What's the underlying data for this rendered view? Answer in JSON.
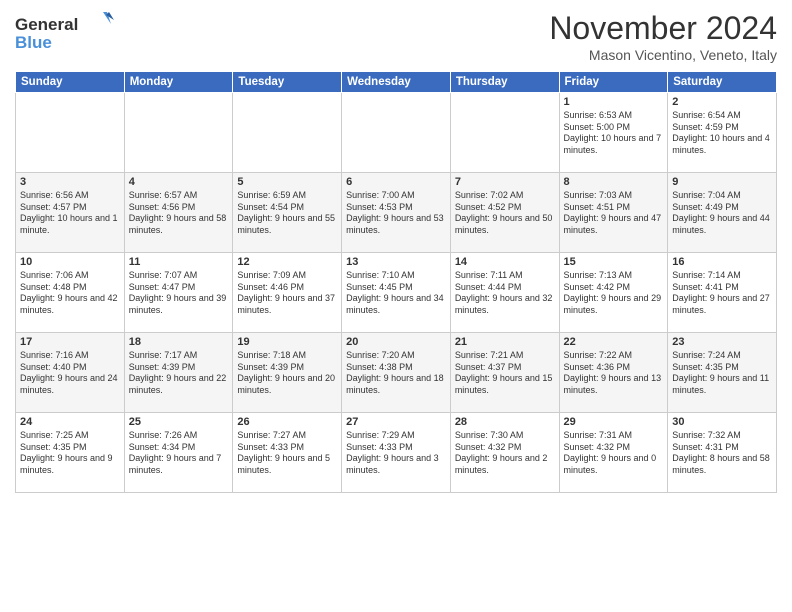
{
  "logo": {
    "line1": "General",
    "line2": "Blue"
  },
  "title": "November 2024",
  "subtitle": "Mason Vicentino, Veneto, Italy",
  "days_of_week": [
    "Sunday",
    "Monday",
    "Tuesday",
    "Wednesday",
    "Thursday",
    "Friday",
    "Saturday"
  ],
  "weeks": [
    [
      {
        "day": "",
        "info": ""
      },
      {
        "day": "",
        "info": ""
      },
      {
        "day": "",
        "info": ""
      },
      {
        "day": "",
        "info": ""
      },
      {
        "day": "",
        "info": ""
      },
      {
        "day": "1",
        "info": "Sunrise: 6:53 AM\nSunset: 5:00 PM\nDaylight: 10 hours and 7 minutes."
      },
      {
        "day": "2",
        "info": "Sunrise: 6:54 AM\nSunset: 4:59 PM\nDaylight: 10 hours and 4 minutes."
      }
    ],
    [
      {
        "day": "3",
        "info": "Sunrise: 6:56 AM\nSunset: 4:57 PM\nDaylight: 10 hours and 1 minute."
      },
      {
        "day": "4",
        "info": "Sunrise: 6:57 AM\nSunset: 4:56 PM\nDaylight: 9 hours and 58 minutes."
      },
      {
        "day": "5",
        "info": "Sunrise: 6:59 AM\nSunset: 4:54 PM\nDaylight: 9 hours and 55 minutes."
      },
      {
        "day": "6",
        "info": "Sunrise: 7:00 AM\nSunset: 4:53 PM\nDaylight: 9 hours and 53 minutes."
      },
      {
        "day": "7",
        "info": "Sunrise: 7:02 AM\nSunset: 4:52 PM\nDaylight: 9 hours and 50 minutes."
      },
      {
        "day": "8",
        "info": "Sunrise: 7:03 AM\nSunset: 4:51 PM\nDaylight: 9 hours and 47 minutes."
      },
      {
        "day": "9",
        "info": "Sunrise: 7:04 AM\nSunset: 4:49 PM\nDaylight: 9 hours and 44 minutes."
      }
    ],
    [
      {
        "day": "10",
        "info": "Sunrise: 7:06 AM\nSunset: 4:48 PM\nDaylight: 9 hours and 42 minutes."
      },
      {
        "day": "11",
        "info": "Sunrise: 7:07 AM\nSunset: 4:47 PM\nDaylight: 9 hours and 39 minutes."
      },
      {
        "day": "12",
        "info": "Sunrise: 7:09 AM\nSunset: 4:46 PM\nDaylight: 9 hours and 37 minutes."
      },
      {
        "day": "13",
        "info": "Sunrise: 7:10 AM\nSunset: 4:45 PM\nDaylight: 9 hours and 34 minutes."
      },
      {
        "day": "14",
        "info": "Sunrise: 7:11 AM\nSunset: 4:44 PM\nDaylight: 9 hours and 32 minutes."
      },
      {
        "day": "15",
        "info": "Sunrise: 7:13 AM\nSunset: 4:42 PM\nDaylight: 9 hours and 29 minutes."
      },
      {
        "day": "16",
        "info": "Sunrise: 7:14 AM\nSunset: 4:41 PM\nDaylight: 9 hours and 27 minutes."
      }
    ],
    [
      {
        "day": "17",
        "info": "Sunrise: 7:16 AM\nSunset: 4:40 PM\nDaylight: 9 hours and 24 minutes."
      },
      {
        "day": "18",
        "info": "Sunrise: 7:17 AM\nSunset: 4:39 PM\nDaylight: 9 hours and 22 minutes."
      },
      {
        "day": "19",
        "info": "Sunrise: 7:18 AM\nSunset: 4:39 PM\nDaylight: 9 hours and 20 minutes."
      },
      {
        "day": "20",
        "info": "Sunrise: 7:20 AM\nSunset: 4:38 PM\nDaylight: 9 hours and 18 minutes."
      },
      {
        "day": "21",
        "info": "Sunrise: 7:21 AM\nSunset: 4:37 PM\nDaylight: 9 hours and 15 minutes."
      },
      {
        "day": "22",
        "info": "Sunrise: 7:22 AM\nSunset: 4:36 PM\nDaylight: 9 hours and 13 minutes."
      },
      {
        "day": "23",
        "info": "Sunrise: 7:24 AM\nSunset: 4:35 PM\nDaylight: 9 hours and 11 minutes."
      }
    ],
    [
      {
        "day": "24",
        "info": "Sunrise: 7:25 AM\nSunset: 4:35 PM\nDaylight: 9 hours and 9 minutes."
      },
      {
        "day": "25",
        "info": "Sunrise: 7:26 AM\nSunset: 4:34 PM\nDaylight: 9 hours and 7 minutes."
      },
      {
        "day": "26",
        "info": "Sunrise: 7:27 AM\nSunset: 4:33 PM\nDaylight: 9 hours and 5 minutes."
      },
      {
        "day": "27",
        "info": "Sunrise: 7:29 AM\nSunset: 4:33 PM\nDaylight: 9 hours and 3 minutes."
      },
      {
        "day": "28",
        "info": "Sunrise: 7:30 AM\nSunset: 4:32 PM\nDaylight: 9 hours and 2 minutes."
      },
      {
        "day": "29",
        "info": "Sunrise: 7:31 AM\nSunset: 4:32 PM\nDaylight: 9 hours and 0 minutes."
      },
      {
        "day": "30",
        "info": "Sunrise: 7:32 AM\nSunset: 4:31 PM\nDaylight: 8 hours and 58 minutes."
      }
    ]
  ]
}
